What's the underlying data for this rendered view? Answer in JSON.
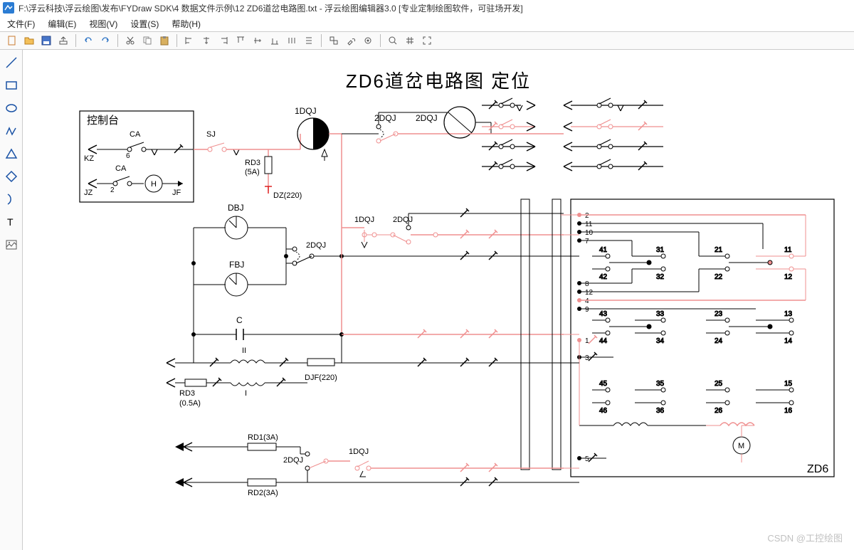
{
  "title": "F:\\浮云科技\\浮云绘图\\发布\\FYDraw SDK\\4 数据文件示例\\12 ZD6道岔电路图.txt - 浮云绘图编辑器3.0 [专业定制绘图软件，可驻场开发]",
  "menu": {
    "file": "文件(F)",
    "edit": "编辑(E)",
    "view": "视图(V)",
    "settings": "设置(S)",
    "help": "帮助(H)"
  },
  "diagram": {
    "title": "ZD6道岔电路图  定位",
    "labels": {
      "control_panel": "控制台",
      "kz": "KZ",
      "jz": "JZ",
      "jf": "JF",
      "ca1": "CA",
      "ca2": "CA",
      "h": "H",
      "sj": "SJ",
      "dqj1": "1DQJ",
      "dqj2": "2DQJ",
      "dqj2b": "2DQJ",
      "dqj1b": "1DQJ",
      "dqj2c": "2DQJ",
      "dqj2d": "2DQJ",
      "dqj2e": "2DQJ",
      "dqj1c": "1DQJ",
      "rd3a": "RD3",
      "rd3a_val": "(5A)",
      "dz": "DZ(220)",
      "dbj": "DBJ",
      "fbj": "FBJ",
      "c": "C",
      "ii": "II",
      "i": "I",
      "rd3b": "RD3",
      "rd3b_val": "(0.5A)",
      "djf": "DJF(220)",
      "rd1": "RD1(3A)",
      "rd2": "RD2(3A)",
      "zd6": "ZD6",
      "m": "M",
      "n2": "2",
      "n11": "11",
      "n10": "10",
      "n7": "7",
      "n8": "8",
      "n12b": "12",
      "n4": "4",
      "n9": "9",
      "n1": "1",
      "n3": "3",
      "n5": "5",
      "t41": "41",
      "t42": "42",
      "t31": "31",
      "t32": "32",
      "t43": "43",
      "t44": "44",
      "t33": "33",
      "t34": "34",
      "t45": "45",
      "t46": "46",
      "t35": "35",
      "t36": "36",
      "t21": "21",
      "t22": "22",
      "t11r": "11",
      "t12": "12",
      "t23": "23",
      "t24": "24",
      "t13": "13",
      "t14": "14",
      "t25": "25",
      "t26": "26",
      "t15": "15",
      "t16": "16",
      "six": "6",
      "two": "2"
    }
  },
  "watermark": "CSDN @工控绘图"
}
